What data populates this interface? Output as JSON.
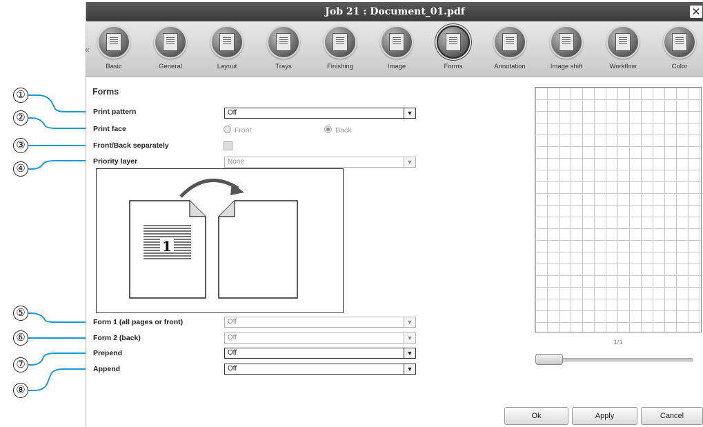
{
  "window": {
    "title": "Job 21 : Document_01.pdf",
    "close_glyph": "✕"
  },
  "toolbar": {
    "scroll_left_glyph": "«",
    "items": [
      {
        "label": "Basic",
        "icon": "document-icon"
      },
      {
        "label": "General",
        "icon": "general-icon"
      },
      {
        "label": "Layout",
        "icon": "layout-icon"
      },
      {
        "label": "Trays",
        "icon": "trays-icon"
      },
      {
        "label": "Finishing",
        "icon": "finishing-icon"
      },
      {
        "label": "Image",
        "icon": "image-icon"
      },
      {
        "label": "Forms",
        "icon": "forms-icon",
        "active": true
      },
      {
        "label": "Annotation",
        "icon": "annotation-icon"
      },
      {
        "label": "Image shift",
        "icon": "image-shift-icon"
      },
      {
        "label": "Workflow",
        "icon": "workflow-icon"
      },
      {
        "label": "Color",
        "icon": "color-icon"
      }
    ]
  },
  "forms": {
    "title": "Forms",
    "print_pattern": {
      "label": "Print pattern",
      "value": "Off"
    },
    "print_face": {
      "label": "Print face",
      "front": "Front",
      "back": "Back",
      "selected": "Back"
    },
    "front_back_separately": {
      "label": "Front/Back separately",
      "checked": false
    },
    "priority_layer": {
      "label": "Priority layer",
      "value": "None"
    },
    "illustration": {
      "page_number": "1"
    },
    "form1": {
      "label": "Form 1 (all pages or front)",
      "value": "Off"
    },
    "form2": {
      "label": "Form 2 (back)",
      "value": "Off"
    },
    "prepend": {
      "label": "Prepend",
      "value": "Off"
    },
    "append": {
      "label": "Append",
      "value": "Off"
    }
  },
  "preview": {
    "page_indicator": "1/1"
  },
  "buttons": {
    "ok": "Ok",
    "apply": "Apply",
    "cancel": "Cancel"
  },
  "callouts": [
    "①",
    "②",
    "③",
    "④",
    "⑤",
    "⑥",
    "⑦",
    "⑧"
  ],
  "colors": {
    "callout_line": "#1a9ad6",
    "titlebar": "#444444"
  }
}
